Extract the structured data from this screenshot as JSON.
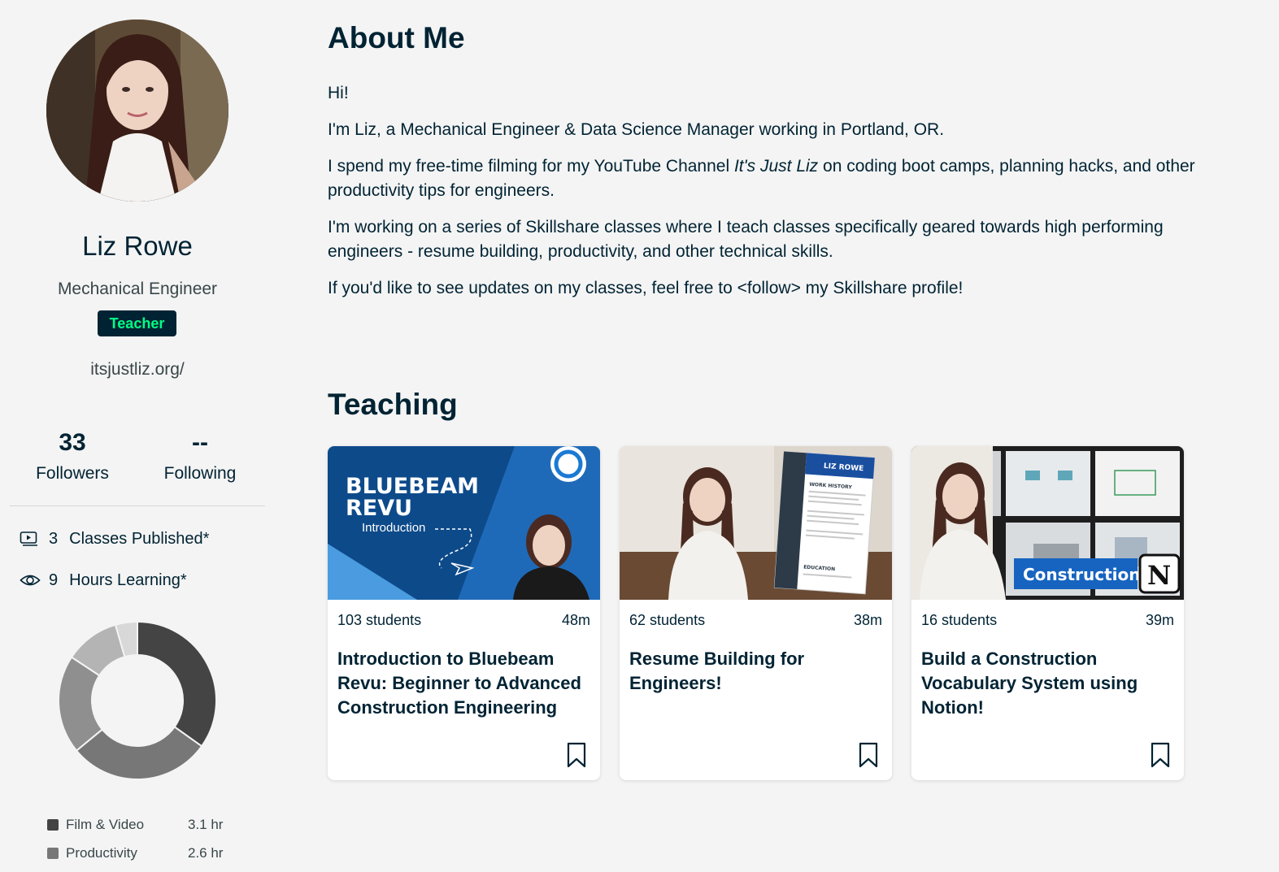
{
  "profile": {
    "name": "Liz Rowe",
    "headline": "Mechanical Engineer",
    "badge": "Teacher",
    "website": "itsjustliz.org/",
    "followers": {
      "count": "33",
      "label": "Followers"
    },
    "following": {
      "count": "--",
      "label": "Following"
    },
    "classes_published": {
      "count": "3",
      "label": "Classes Published*"
    },
    "hours_learning": {
      "count": "9",
      "label": "Hours Learning*"
    }
  },
  "learning_chart": {
    "segments": [
      {
        "label": "Film & Video",
        "value": "3.1 hr",
        "hours": 3.1,
        "color": "#444444"
      },
      {
        "label": "Productivity",
        "value": "2.6 hr",
        "hours": 2.6,
        "color": "#777777"
      },
      {
        "label": "",
        "hours": 1.8,
        "color": "#8f8f8f"
      },
      {
        "label": "",
        "hours": 1.0,
        "color": "#b4b4b4"
      },
      {
        "label": "",
        "hours": 0.4,
        "color": "#d8d8d8"
      }
    ]
  },
  "about": {
    "title": "About Me",
    "p1": "Hi!",
    "p2": "I'm Liz, a Mechanical Engineer & Data Science Manager working in Portland, OR.",
    "p3_before": "I spend my free-time filming for my YouTube Channel ",
    "p3_italic": "It's Just Liz",
    "p3_after": " on coding boot camps, planning hacks, and other productivity tips for engineers.",
    "p4": "I'm working on a series of Skillshare classes where I teach classes specifically geared towards high performing engineers - resume building, productivity, and other technical skills.",
    "p5": "If you'd like to see updates on my classes, feel free to <follow> my Skillshare profile!"
  },
  "teaching": {
    "title": "Teaching",
    "classes": [
      {
        "students": "103 students",
        "duration": "48m",
        "title": "Introduction to Bluebeam Revu: Beginner to Advanced Construction Engineering",
        "thumb_line1": "BLUEBEAM",
        "thumb_line2": "REVU",
        "thumb_line3": "Introduction"
      },
      {
        "students": "62 students",
        "duration": "38m",
        "title": "Resume Building for Engineers!",
        "thumb_name": "LIZ ROWE",
        "thumb_section1": "WORK HISTORY",
        "thumb_section2": "EDUCATION"
      },
      {
        "students": "16 students",
        "duration": "39m",
        "title": "Build a Construction Vocabulary System using Notion!",
        "thumb_tag": "Construction",
        "thumb_logo": "N"
      }
    ]
  }
}
